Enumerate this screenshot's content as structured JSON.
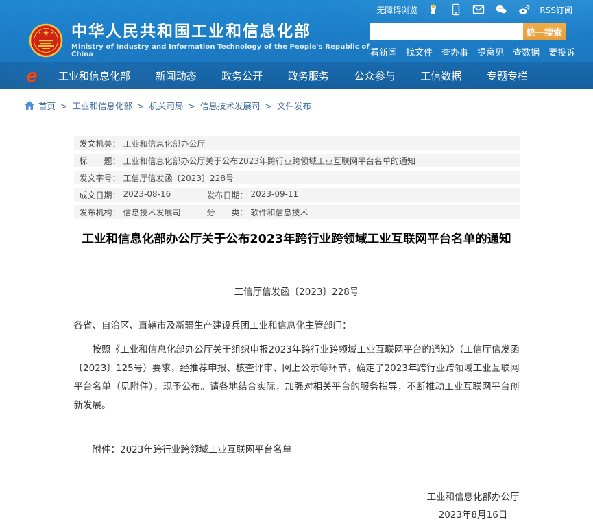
{
  "topbar": {
    "accessibility_label": "无障碍浏览",
    "rss_label": "RSS订阅",
    "icons": [
      "mascot-icon",
      "mobile-icon",
      "mail-icon",
      "wechat-icon",
      "weibo-icon"
    ]
  },
  "header": {
    "title_cn": "中华人民共和国工业和信息化部",
    "title_en": "Ministry of Industry and Information Technology of the People's Republic of China",
    "search": {
      "value": "",
      "placeholder": "",
      "button_label": "统一搜索"
    },
    "quick_links": [
      "看新闻",
      "找文件",
      "查办事",
      "提意见",
      "查数据",
      "要投诉"
    ]
  },
  "nav": {
    "items": [
      "工业和信息化部",
      "新闻动态",
      "政务公开",
      "政务服务",
      "公众参与",
      "工信数据",
      "专题专栏"
    ]
  },
  "breadcrumb": {
    "items": [
      "首页",
      "工业和信息化部",
      "机关司局",
      "信息技术发展司",
      "文件发布"
    ]
  },
  "meta": {
    "rows": [
      {
        "cells": [
          {
            "label": "发文机关：",
            "value": "工业和信息化部办公厅"
          }
        ]
      },
      {
        "cells": [
          {
            "label": "标　　题：",
            "value": "工业和信息化部办公厅关于公布2023年跨行业跨领域工业互联网平台名单的通知"
          }
        ]
      },
      {
        "cells": [
          {
            "label": "发文字号：",
            "value": "工信厅信发函〔2023〕228号"
          }
        ]
      },
      {
        "cells": [
          {
            "label": "成文日期：",
            "value": "2023-08-16"
          },
          {
            "label": "发布日期：",
            "value": "2023-09-11"
          }
        ]
      },
      {
        "cells": [
          {
            "label": "发布机构：",
            "value": "信息技术发展司"
          },
          {
            "label": "分　　类：",
            "value": "软件和信息技术"
          }
        ]
      }
    ]
  },
  "article": {
    "title": "工业和信息化部办公厅关于公布2023年跨行业跨领域工业互联网平台名单的通知",
    "doc_number": "工信厅信发函〔2023〕228号",
    "salutation": "各省、自治区、直辖市及新疆生产建设兵团工业和信息化主管部门：",
    "paragraph": "按照《工业和信息化部办公厅关于组织申报2023年跨行业跨领域工业互联网平台的通知》（工信厅信发函〔2023〕125号）要求，经推荐申报、核查评审、网上公示等环节，确定了2023年跨行业跨领域工业互联网平台名单（见附件），现予公布。请各地结合实际，加强对相关平台的服务指导，不断推动工业互联网平台创新发展。",
    "attachment": "附件：2023年跨行业跨领域工业互联网平台名单",
    "signer": "工业和信息化部办公厅",
    "date": "2023年8月16日"
  },
  "colors": {
    "header_blue": "#1c7cc6",
    "nav_blue": "#175f9e",
    "search_button_orange": "#e69d36",
    "breadcrumb_blue": "#3c6a9e",
    "meta_row_gray": "#f4f4f4",
    "nav_logo_red": "#e8491f"
  }
}
